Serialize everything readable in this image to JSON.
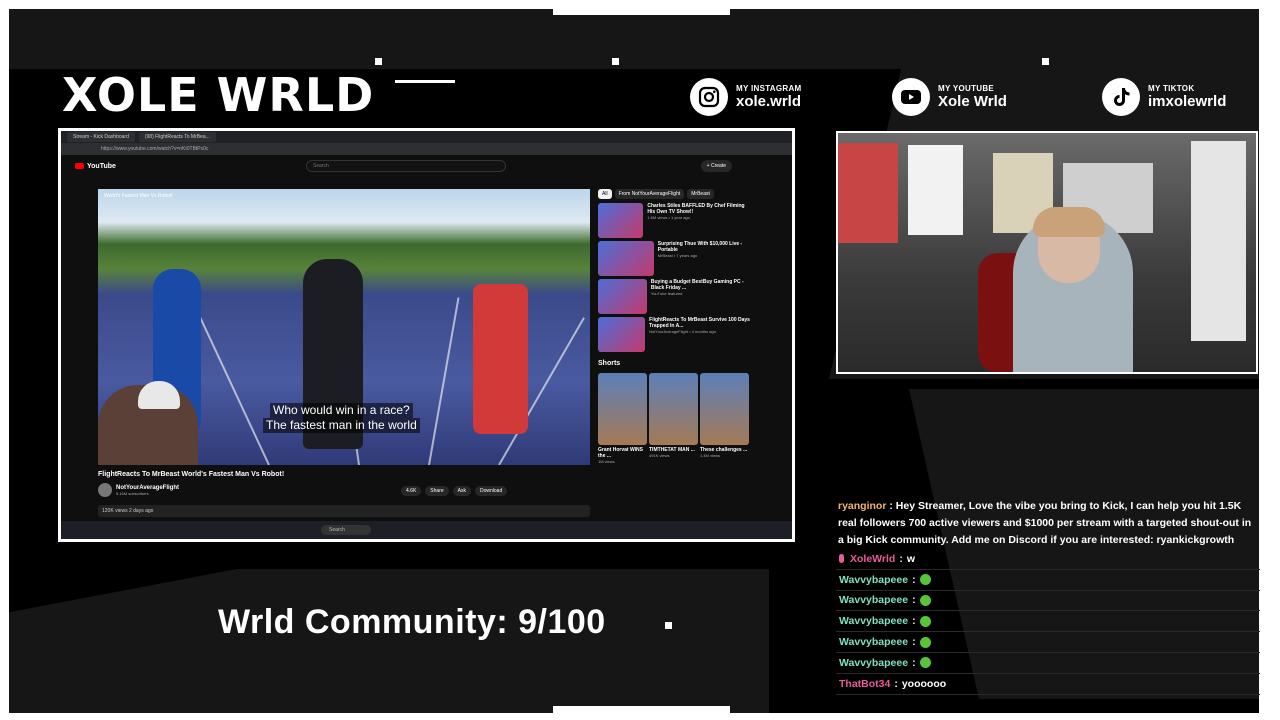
{
  "overlay": {
    "brand": "XOLE WRLD",
    "community": "Wrld Community: 9/100"
  },
  "socials": [
    {
      "caption": "MY INSTAGRAM",
      "handle": "xole.wrld",
      "icon": "instagram-icon"
    },
    {
      "caption": "MY YOUTUBE",
      "handle": "Xole Wrld",
      "icon": "youtube-icon"
    },
    {
      "caption": "MY TIKTOK",
      "handle": "imxolewrld",
      "icon": "tiktok-icon"
    }
  ],
  "browser": {
    "tabs": [
      "Stream - Kick Dashboard",
      "(98) FlightReacts To MrBea..."
    ],
    "url": "https://www.youtube.com/watch?v=nKt0TBtPs0c"
  },
  "youtube": {
    "logo": "YouTube",
    "search_placeholder": "Search",
    "create_label": "+ Create",
    "player_title": "World's Fastest Man Vs Robot!",
    "subtitle_line1": "Who would win in a race?",
    "subtitle_line2": "The fastest man in the world",
    "video_title": "FlightReacts To MrBeast World's Fastest Man Vs Robot!",
    "channel": "NotYourAverageFlight",
    "subs": "5.16M subscribers",
    "like": "4.6K",
    "share": "Share",
    "ask": "Ask",
    "download": "Download",
    "views": "120K views  2 days ago",
    "chips": [
      "All",
      "From NotYourAverageFlight",
      "MrBeast"
    ],
    "recommended": [
      {
        "title": "Charles Stiles BAFFLED By Chef Filming His Own TV Show!!",
        "meta": "1.6M views • 1 year ago"
      },
      {
        "title": "Surprising Thue With $10,000 Live - Portable",
        "meta": "MrBeast • 7 years ago"
      },
      {
        "title": "Buying a Budget BestBuy Gaming PC - Black Friday ...",
        "meta": "YouTube featured"
      },
      {
        "title": "FlightReacts To MrBeast Survive 100 Days Trapped In A...",
        "meta": "NotYourAverageFlight • 4 months ago"
      }
    ],
    "shorts_heading": "Shorts",
    "shorts": [
      {
        "title": "Grant Horvat WINS the ...",
        "views": "1M views"
      },
      {
        "title": "TIMTHETAT MAN ...",
        "views": "491K views"
      },
      {
        "title": "These challenges ...",
        "views": "1.4M views"
      }
    ],
    "taskbar_search": "Search"
  },
  "chat": {
    "first": {
      "user": "ryanginor",
      "text": "Hey Streamer, Love the vibe you bring to Kick, I can help you hit 1.5K real followers  700  active viewers and $1000 per  stream with a targeted shout-out in a big Kick community. Add me on Discord if you are interested:   ryankickgrowth"
    },
    "rows": [
      {
        "user": "XoleWrld",
        "text": "w",
        "color": "#e75b9a",
        "emote": false,
        "mic": true
      },
      {
        "user": "Wavvybapeee",
        "text": "",
        "color": "#7fe0c3",
        "emote": true,
        "mic": false
      },
      {
        "user": "Wavvybapeee",
        "text": "",
        "color": "#7fe0c3",
        "emote": true,
        "mic": false
      },
      {
        "user": "Wavvybapeee",
        "text": "",
        "color": "#7fe0c3",
        "emote": true,
        "mic": false
      },
      {
        "user": "Wavvybapeee",
        "text": "",
        "color": "#7fe0c3",
        "emote": true,
        "mic": false
      },
      {
        "user": "Wavvybapeee",
        "text": "",
        "color": "#7fe0c3",
        "emote": true,
        "mic": false
      },
      {
        "user": "ThatBot34",
        "text": "yoooooo",
        "color": "#e75b9a",
        "emote": false,
        "mic": false
      }
    ]
  }
}
